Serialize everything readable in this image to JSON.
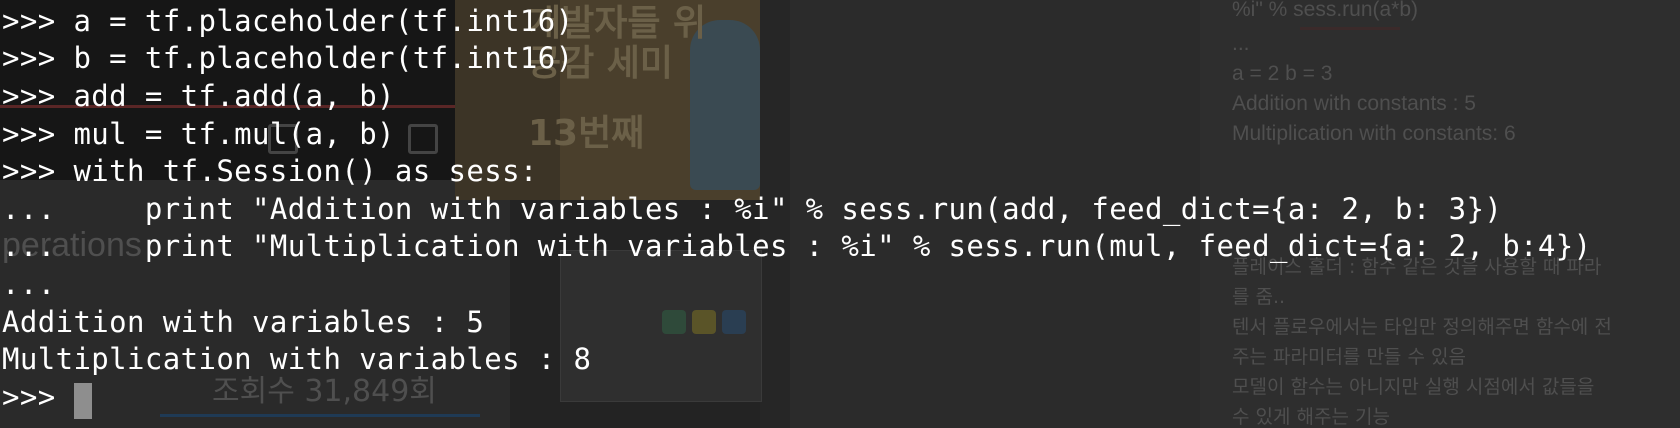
{
  "terminal": {
    "lines": [
      ">>> a = tf.placeholder(tf.int16)",
      ">>> b = tf.placeholder(tf.int16)",
      ">>> add = tf.add(a, b)",
      ">>> mul = tf.mul(a, b)",
      ">>> with tf.Session() as sess:",
      "...     print \"Addition with variables : %i\" % sess.run(add, feed_dict={a: 2, b: 3})",
      "...     print \"Multiplication with variables : %i\" % sess.run(mul, feed_dict={a: 2, b:4})",
      "...",
      "Addition with variables : 5",
      "Multiplication with variables : 8",
      ">>> "
    ],
    "cursor_color": "#8e8e8e",
    "text_color": "#ffffff"
  },
  "background": {
    "left_heading_fragment": "perations",
    "view_count": "조회수 31,849회",
    "video_sign_lines": [
      "개발자들 위",
      "공감 세미",
      "13번째"
    ],
    "right_notes": [
      "%i\" % sess.run(a*b)",
      "...",
      "a = 2 b = 3",
      "Addition with constants : 5",
      "Multiplication with constants: 6",
      "플레이스 홀더 : 함수 같은 것을 사용할 때 파라",
      "를 줌..",
      "텐서 플로우에서는 타입만 정의해주면 함수에 전",
      "주는 파라미터를 만들 수 있음",
      "모델이 함수는 아니지만 실행 시점에서 값들을 ",
      "수 있게 해주는 기능"
    ]
  }
}
